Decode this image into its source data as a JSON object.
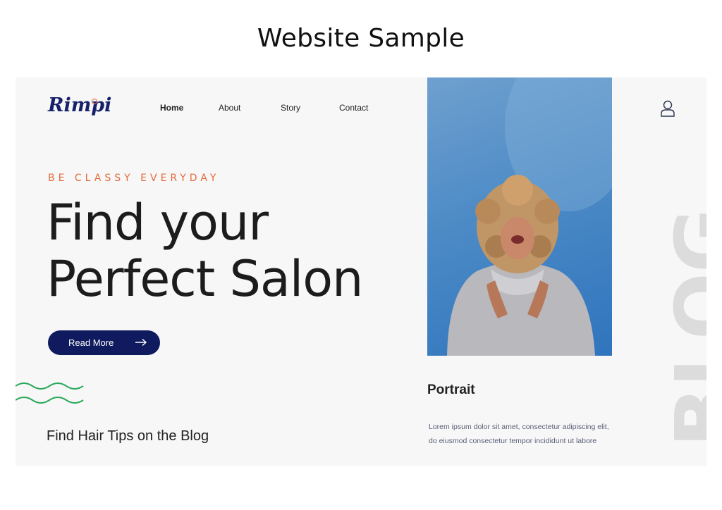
{
  "page": {
    "heading": "Website Sample"
  },
  "header": {
    "logo": "Rimpi",
    "nav": [
      {
        "label": "Home",
        "active": true
      },
      {
        "label": "About"
      },
      {
        "label": "Story"
      },
      {
        "label": "Contact"
      }
    ],
    "profile_icon": "user-icon"
  },
  "hero": {
    "eyebrow": "BE CLASSY EVERYDAY",
    "headline_line1": "Find your",
    "headline_line2": "Perfect Salon",
    "cta_label": "Read More",
    "cta_icon": "arrow-right-icon",
    "tips_text": "Find Hair Tips on the Blog"
  },
  "portrait": {
    "title": "Portrait",
    "body_line1": "Lorem ipsum dolor sit amet, consectetur adipiscing elit,",
    "body_line2": "do eiusmod consectetur tempor incididunt ut labore"
  },
  "decor": {
    "watermark": "BLOG"
  },
  "colors": {
    "accent": "#e46a3d",
    "primary": "#0f1b5e",
    "wave": "#2aa85a",
    "photo_bg": "#4d8bc6",
    "panel_bg": "#f7f7f7"
  }
}
